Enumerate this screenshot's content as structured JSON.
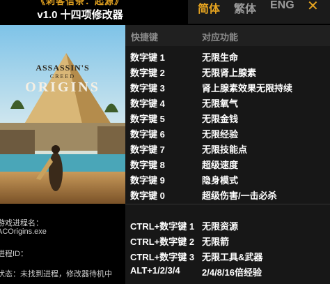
{
  "header": {
    "game_title": "《刺客信条：起源》",
    "version": "v1.0 十四项修改器"
  },
  "languages": [
    {
      "label": "简体",
      "active": true
    },
    {
      "label": "繁体",
      "active": false
    },
    {
      "label": "ENG",
      "active": false
    }
  ],
  "close_label": "✕",
  "cover": {
    "logo_line1": "ASSASSIN'S",
    "logo_line2": "CREED",
    "logo_line3": "ORIGINS"
  },
  "table": {
    "col_key": "快捷键",
    "col_function": "对应功能",
    "rows": [
      {
        "key": "数字键 1",
        "function": "无限生命"
      },
      {
        "key": "数字键 2",
        "function": "无限肾上腺素"
      },
      {
        "key": "数字键 3",
        "function": "肾上腺素效果无限持续"
      },
      {
        "key": "数字键 4",
        "function": "无限氧气"
      },
      {
        "key": "数字键 5",
        "function": "无限金钱"
      },
      {
        "key": "数字键 6",
        "function": "无限经验"
      },
      {
        "key": "数字键 7",
        "function": "无限技能点"
      },
      {
        "key": "数字键 8",
        "function": "超级速度"
      },
      {
        "key": "数字键 9",
        "function": "隐身模式"
      },
      {
        "key": "数字键 0",
        "function": "超级伤害/一击必杀"
      }
    ],
    "rows2": [
      {
        "key": "CTRL+数字键 1",
        "function": "无限资源"
      },
      {
        "key": "CTRL+数字键 2",
        "function": "无限箭"
      },
      {
        "key": "CTRL+数字键 3",
        "function": "无限工具&武器"
      },
      {
        "key": "ALT+1/2/3/4",
        "function": "2/4/8/16倍经验"
      }
    ]
  },
  "info": {
    "process_label": "游戏进程名：",
    "process_name": "ACOrigins.exe",
    "pid_label": "进程ID：",
    "status": "状态：未找到进程，修改器待机中"
  },
  "colors": {
    "accent": "#e6a420",
    "panel": "#171717"
  }
}
